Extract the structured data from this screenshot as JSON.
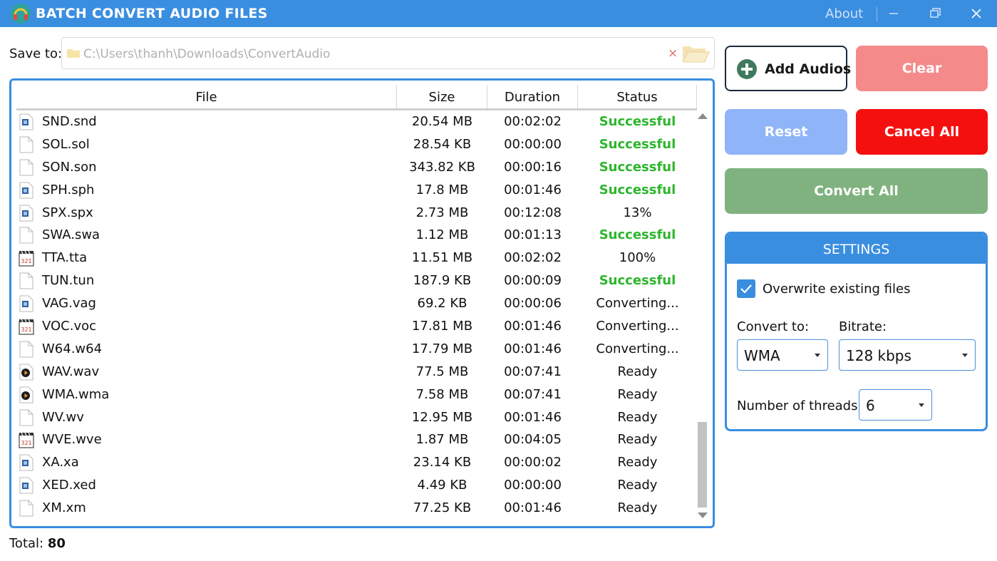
{
  "window": {
    "title": "BATCH CONVERT AUDIO FILES",
    "about_label": "About",
    "accent_color": "#3a8ee0"
  },
  "save_to": {
    "label": "Save to:",
    "path_placeholder": "C:\\Users\\thanh\\Downloads\\ConvertAudio",
    "clear_glyph": "×"
  },
  "table": {
    "headers": {
      "file": "File",
      "size": "Size",
      "duration": "Duration",
      "status": "Status"
    },
    "rows": [
      {
        "icon": "audio-file-icon",
        "file": "SND.snd",
        "size": "20.54 MB",
        "duration": "00:02:02",
        "status": "Successful"
      },
      {
        "icon": "blank-file-icon",
        "file": "SOL.sol",
        "size": "28.54 KB",
        "duration": "00:00:00",
        "status": "Successful"
      },
      {
        "icon": "blank-file-icon",
        "file": "SON.son",
        "size": "343.82 KB",
        "duration": "00:00:16",
        "status": "Successful"
      },
      {
        "icon": "audio-file-icon",
        "file": "SPH.sph",
        "size": "17.8 MB",
        "duration": "00:01:46",
        "status": "Successful"
      },
      {
        "icon": "audio-file-icon",
        "file": "SPX.spx",
        "size": "2.73 MB",
        "duration": "00:12:08",
        "status": "13%"
      },
      {
        "icon": "blank-file-icon",
        "file": "SWA.swa",
        "size": "1.12 MB",
        "duration": "00:01:13",
        "status": "Successful"
      },
      {
        "icon": "clapper-file-icon",
        "file": "TTA.tta",
        "size": "11.51 MB",
        "duration": "00:02:02",
        "status": "100%"
      },
      {
        "icon": "blank-file-icon",
        "file": "TUN.tun",
        "size": "187.9 KB",
        "duration": "00:00:09",
        "status": "Successful"
      },
      {
        "icon": "audio-file-icon",
        "file": "VAG.vag",
        "size": "69.2 KB",
        "duration": "00:00:06",
        "status": "Converting..."
      },
      {
        "icon": "clapper-file-icon",
        "file": "VOC.voc",
        "size": "17.81 MB",
        "duration": "00:01:46",
        "status": "Converting..."
      },
      {
        "icon": "blank-file-icon",
        "file": "W64.w64",
        "size": "17.79 MB",
        "duration": "00:01:46",
        "status": "Converting..."
      },
      {
        "icon": "media-file-icon",
        "file": "WAV.wav",
        "size": "77.5 MB",
        "duration": "00:07:41",
        "status": "Ready"
      },
      {
        "icon": "media-file-icon",
        "file": "WMA.wma",
        "size": "7.58 MB",
        "duration": "00:07:41",
        "status": "Ready"
      },
      {
        "icon": "blank-file-icon",
        "file": "WV.wv",
        "size": "12.95 MB",
        "duration": "00:01:46",
        "status": "Ready"
      },
      {
        "icon": "clapper-file-icon",
        "file": "WVE.wve",
        "size": "1.87 MB",
        "duration": "00:04:05",
        "status": "Ready"
      },
      {
        "icon": "audio-file-icon",
        "file": "XA.xa",
        "size": "23.14 KB",
        "duration": "00:00:02",
        "status": "Ready"
      },
      {
        "icon": "audio-file-icon",
        "file": "XED.xed",
        "size": "4.49 KB",
        "duration": "00:00:00",
        "status": "Ready"
      },
      {
        "icon": "blank-file-icon",
        "file": "XM.xm",
        "size": "77.25 KB",
        "duration": "00:01:46",
        "status": "Ready"
      }
    ],
    "success_color": "#2db52d"
  },
  "footer": {
    "total_label": "Total:",
    "total_value": "80"
  },
  "actions": {
    "add_audios": "Add Audios",
    "clear": "Clear",
    "reset": "Reset",
    "cancel_all": "Cancel All",
    "convert_all": "Convert All",
    "colors": {
      "clear": "#f58a8a",
      "reset": "#8fb4f8",
      "cancel_all": "#f51010",
      "convert_all": "#7fb27f"
    }
  },
  "settings": {
    "title": "SETTINGS",
    "overwrite_label": "Overwrite existing files",
    "overwrite_checked": true,
    "convert_to_label": "Convert to:",
    "convert_to_value": "WMA",
    "bitrate_label": "Bitrate:",
    "bitrate_value": "128 kbps",
    "threads_label": "Number of threads:",
    "threads_value": "6"
  }
}
